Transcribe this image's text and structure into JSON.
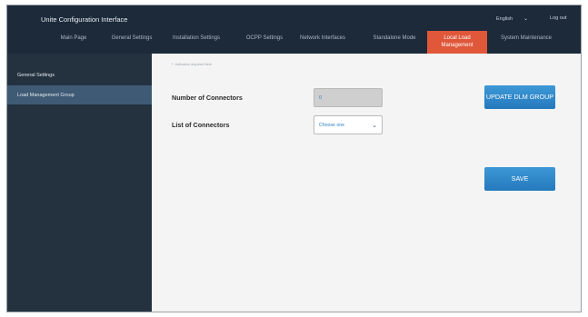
{
  "header": {
    "title": "Unite Configuration Interface",
    "language": "English",
    "logout": "Log out"
  },
  "nav": {
    "items": [
      {
        "label": "Main Page"
      },
      {
        "label": "General Settings"
      },
      {
        "label": "Installation Settings"
      },
      {
        "label": "OCPP Settings"
      },
      {
        "label": "Network Interfaces"
      },
      {
        "label": "Standalone Mode"
      },
      {
        "label": "Local Load Management",
        "active": true
      },
      {
        "label": "System Maintenance"
      }
    ]
  },
  "sidebar": {
    "items": [
      {
        "label": "General Settings"
      },
      {
        "label": "Load Management Group",
        "selected": true
      }
    ]
  },
  "form": {
    "required_note": "Indicates required field",
    "number_of_connectors_label": "Number of Connectors",
    "number_of_connectors_value": "0",
    "list_of_connectors_label": "List of Connectors",
    "list_of_connectors_selected": "Choose one",
    "update_button": "UPDATE DLM GROUP",
    "save_button": "SAVE"
  },
  "colors": {
    "header_bg": "#1c2a3a",
    "sidebar_bg": "#243240",
    "sidebar_selected": "#3f5a74",
    "active_tab": "#e0573a",
    "button": "#2e86c8"
  }
}
